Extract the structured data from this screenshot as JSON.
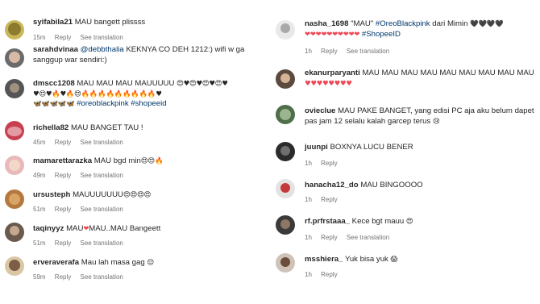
{
  "ui": {
    "reply_label": "Reply",
    "translate_label": "See translation"
  },
  "comments_left": [
    {
      "username": "syifabila21",
      "text": "MAU bangett plissss",
      "time": "15m",
      "translate": true
    },
    {
      "username": "sarahdvinaa",
      "mention": "@debbthalia",
      "text": " KEKNYA CO DEH 1212:) wifi w ga sanggup war sendiri:)",
      "time": "",
      "translate": false
    },
    {
      "username": "dmscc1208",
      "text": "MAU MAU MAU MAUUUUU ",
      "emoji_line1": "😍♥😍♥😍♥😍♥",
      "emoji_line2": "♥😍♥🔥♥🔥😍🔥🔥🔥🔥🔥🔥🔥🔥🔥♥",
      "emoji_line3": "🦋🦋🦋🦋🦋",
      "tags": "#oreoblackpink #shopeeid",
      "time": "",
      "translate": false
    },
    {
      "username": "richella82",
      "text": "MAU BANGET TAU !",
      "time": "45m",
      "translate": true
    },
    {
      "username": "mamarettarazka",
      "text": "MAU bgd min",
      "emoji": "😍😍🔥",
      "time": "49m",
      "translate": true
    },
    {
      "username": "ursusteph",
      "text": "MAUUUUUUU",
      "emoji": "😍😍😍😍",
      "time": "51m",
      "translate": true
    },
    {
      "username": "taqinyyz",
      "text": "MAU",
      "emoji": "❤",
      "text2": "MAU..MAU Bangeett",
      "time": "51m",
      "translate": true
    },
    {
      "username": "erveraverafa",
      "text": "Mau lah masa gag",
      "emoji": "😔",
      "time": "59m",
      "translate": true
    }
  ],
  "comments_right": [
    {
      "username": "nasha_1698",
      "text": "\"MAU\" ",
      "tags_inline": "#OreoBlackpink",
      "text2": " dari Mimin",
      "emoji_line1": "🖤🖤🖤🖤",
      "emoji_line2": "❤❤❤❤❤❤❤❤❤❤",
      "tags": "#ShopeeID",
      "time": "1h",
      "translate": true
    },
    {
      "username": "ekanurparyanti",
      "text": "MAU MAU MAU MAU MAU MAU MAU MAU MAU",
      "emoji_line1": "♥♥♥♥♥♥♥♥",
      "time": "",
      "translate": false
    },
    {
      "username": "ovieclue",
      "text": "MAU PAKE BANGET, yang edisi PC aja aku belum dapet pas jam 12 selalu kalah garcep terus",
      "emoji": "😢",
      "time": "",
      "translate": false
    },
    {
      "username": "juunpi",
      "text": "BOXNYA LUCU BENER",
      "time": "1h",
      "translate": false
    },
    {
      "username": "hanacha12_do",
      "text": "MAU BINGOOOO",
      "time": "1h",
      "translate": false
    },
    {
      "username": "rf.prfrstaaa_",
      "text": "Kece bgt mauu",
      "emoji": "😍",
      "time": "1h",
      "translate": true
    },
    {
      "username": "msshiera_",
      "text": "Yuk bisa yuk",
      "emoji": "😱",
      "time": "1h",
      "translate": false
    }
  ],
  "colors": {
    "text": "#262626",
    "meta": "#737373",
    "hashtag": "#00376b",
    "heart": "#ed4956",
    "fire": "#f28c28"
  }
}
